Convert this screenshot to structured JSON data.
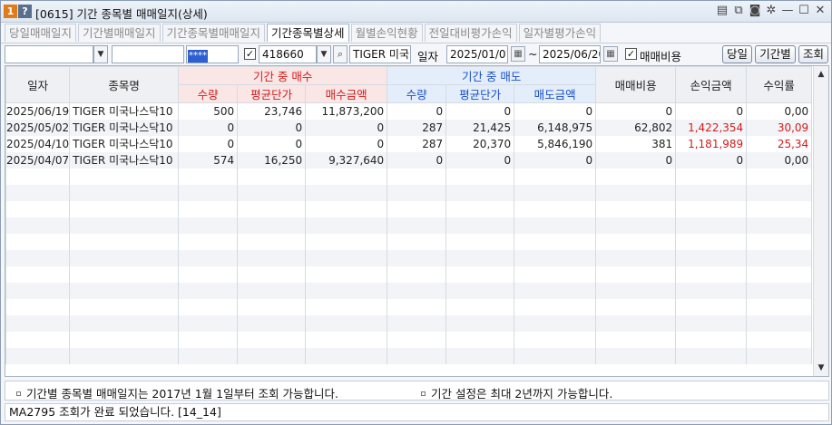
{
  "window": {
    "badge1": "1",
    "badge2": "?",
    "title": "[0615] 기간 종목별 매매일지(상세)"
  },
  "tabs": [
    "당일매매일지",
    "기간별매매일지",
    "기간종목별매매일지",
    "기간종목별상세",
    "월별손익현황",
    "전일대비평가손익",
    "일자별평가손익"
  ],
  "active_tab": 3,
  "toolbar": {
    "account": "",
    "account2": "",
    "password_mask": "****",
    "stock_code": "418660",
    "stock_name": "TIGER 미국",
    "date_label": "일자",
    "date_from": "2025/01/01",
    "tilde": "~",
    "date_to": "2025/06/20",
    "fee_label": "매매비용",
    "btn_today": "당일",
    "btn_period": "기간별",
    "btn_query": "조회",
    "chk_mark": "✓"
  },
  "grid": {
    "headers": {
      "date": "일자",
      "name": "종목명",
      "buy_group": "기간 중 매수",
      "sell_group": "기간 중 매도",
      "fee": "매매비용",
      "pnl": "손익금액",
      "rate": "수익률",
      "qty": "수량",
      "avg": "평균단가",
      "buy_amt": "매수금액",
      "sell_amt": "매도금액"
    },
    "rows": [
      {
        "date": "2025/06/19",
        "name": "TIGER 미국나스닥10",
        "bqty": "500",
        "bavg": "23,746",
        "bamt": "11,873,200",
        "sqty": "0",
        "savg": "0",
        "samt": "0",
        "fee": "0",
        "pnl": "0",
        "rate": "0,00",
        "red": false
      },
      {
        "date": "2025/05/02",
        "name": "TIGER 미국나스닥10",
        "bqty": "0",
        "bavg": "0",
        "bamt": "0",
        "sqty": "287",
        "savg": "21,425",
        "samt": "6,148,975",
        "fee": "62,802",
        "pnl": "1,422,354",
        "rate": "30,09",
        "red": true
      },
      {
        "date": "2025/04/10",
        "name": "TIGER 미국나스닥10",
        "bqty": "0",
        "bavg": "0",
        "bamt": "0",
        "sqty": "287",
        "savg": "20,370",
        "samt": "5,846,190",
        "fee": "381",
        "pnl": "1,181,989",
        "rate": "25,34",
        "red": true
      },
      {
        "date": "2025/04/07",
        "name": "TIGER 미국나스닥10",
        "bqty": "574",
        "bavg": "16,250",
        "bamt": "9,327,640",
        "sqty": "0",
        "savg": "0",
        "samt": "0",
        "fee": "0",
        "pnl": "0",
        "rate": "0,00",
        "red": false
      }
    ],
    "empty_rows": 12
  },
  "notes": {
    "left": "기간별 종목별 매매일지는 2017년 1월 1일부터 조회 가능합니다.",
    "right": "기간 설정은 최대 2년까지 가능합니다."
  },
  "status": "MA2795 조회가 완료 되었습니다. [14_14]",
  "colors": {
    "accent_red": "#d11c1c",
    "accent_blue": "#1c4fc9",
    "badge_orange": "#e07b1a"
  },
  "icons": [
    "notes-icon",
    "copy-icon",
    "camera-icon",
    "gear-icon",
    "minimize-icon",
    "maximize-icon",
    "close-icon",
    "dropdown-arrow-icon",
    "search-icon",
    "calendar-icon",
    "scroll-up-icon",
    "scroll-down-icon"
  ]
}
